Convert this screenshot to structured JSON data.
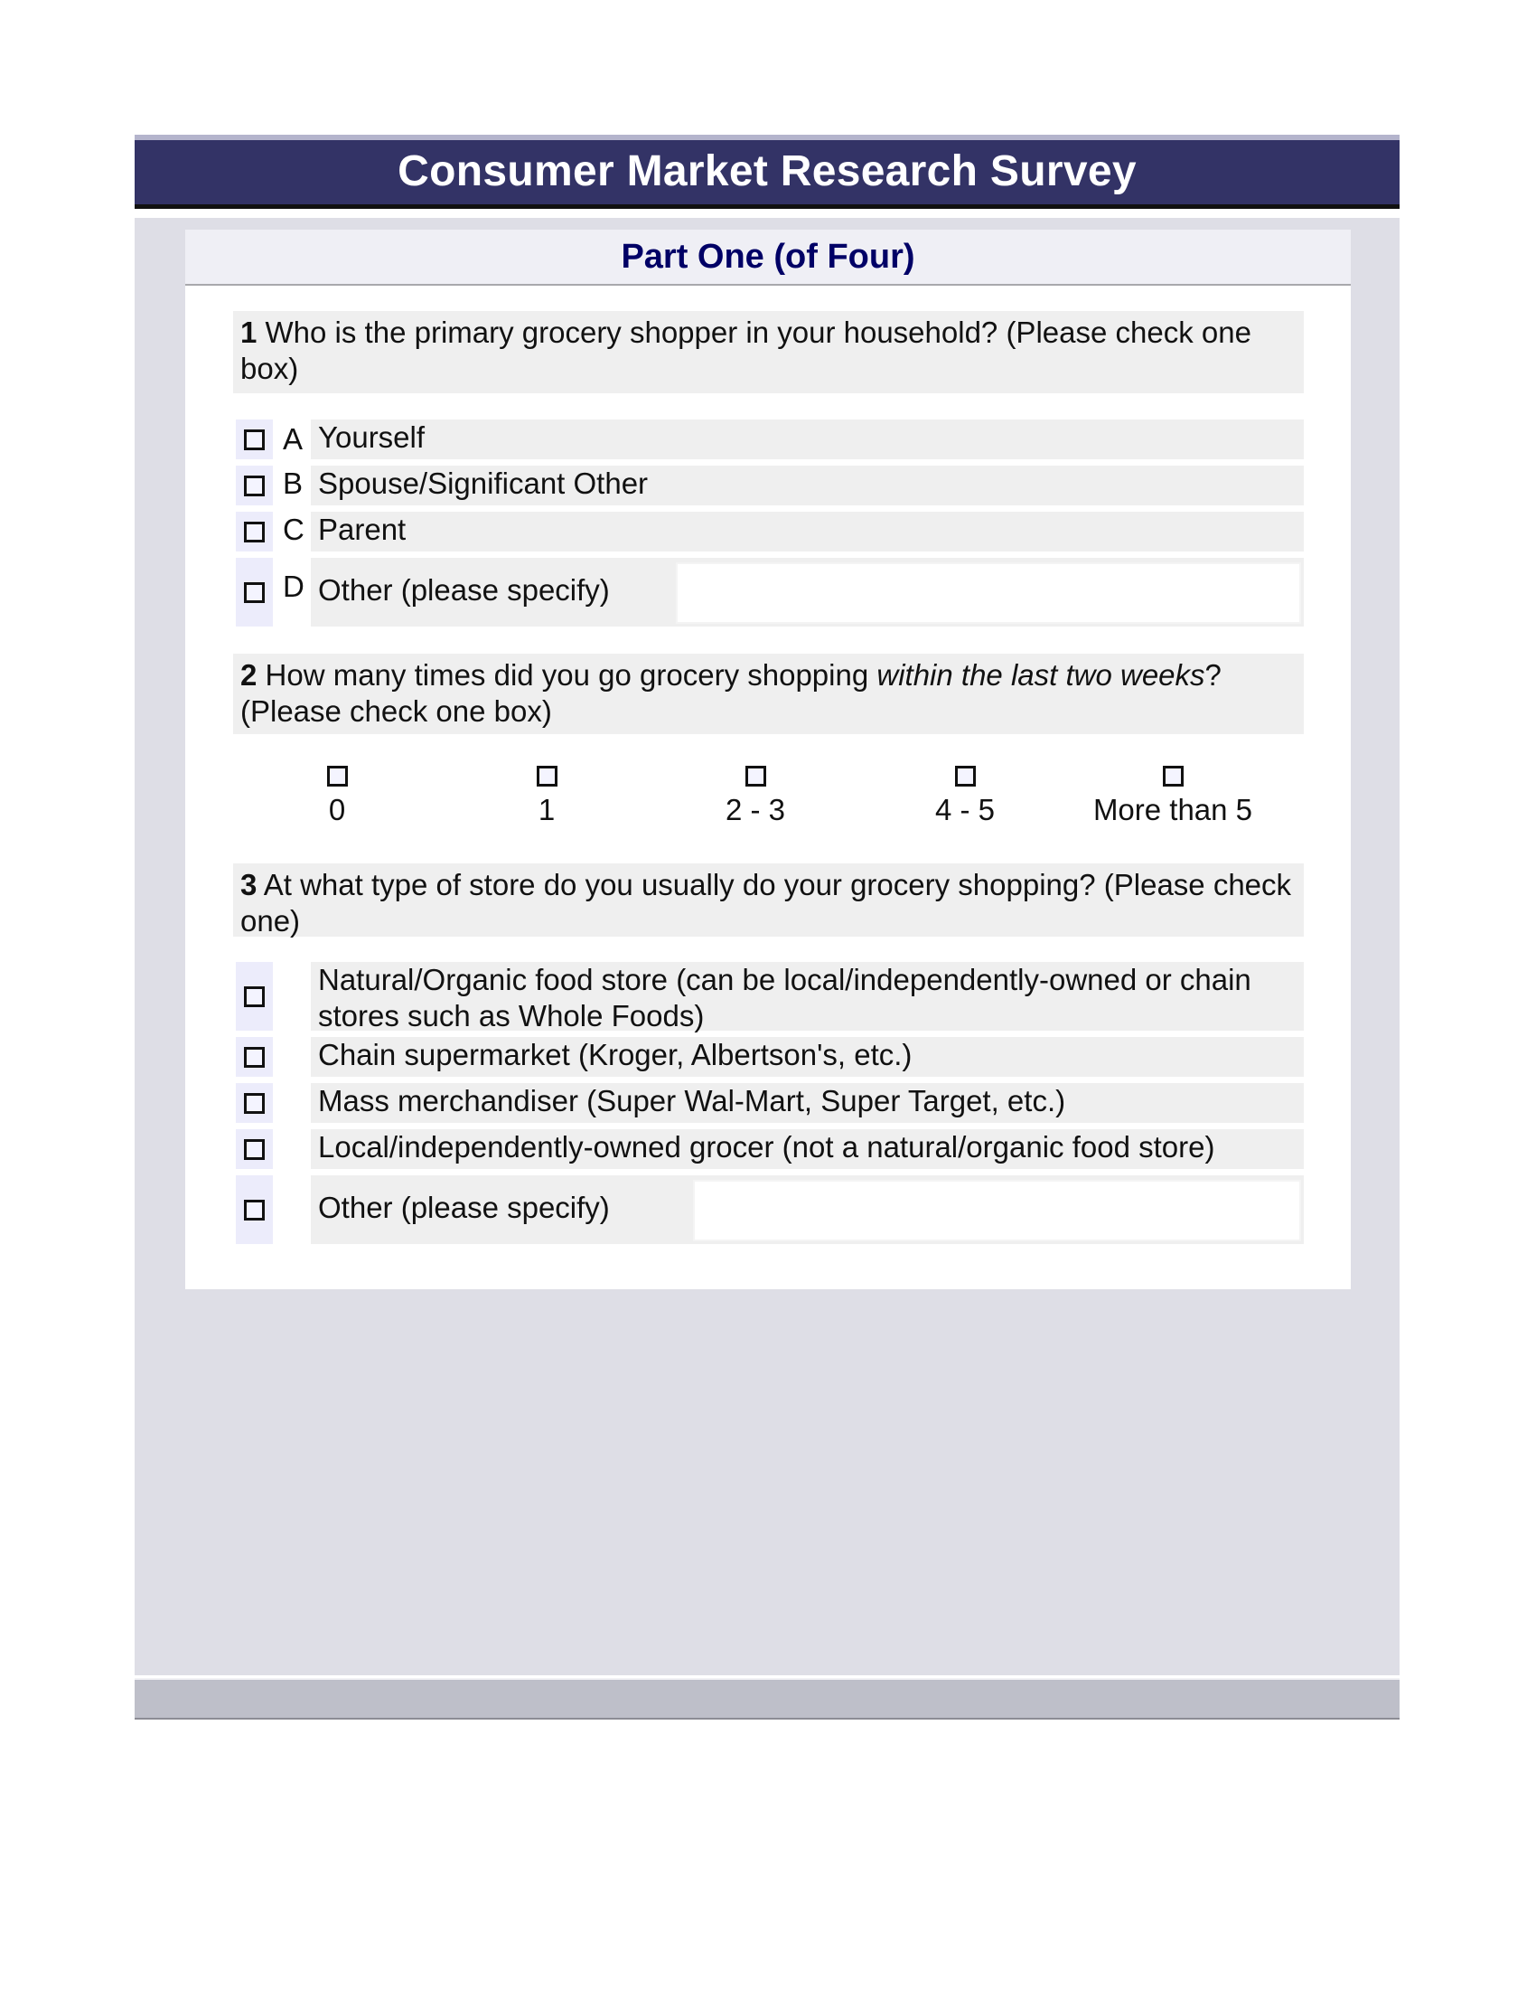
{
  "header": {
    "title": "Consumer Market Research Survey"
  },
  "section": {
    "title": "Part One (of Four)"
  },
  "questions": [
    {
      "number": "1",
      "text": "Who is the primary grocery shopper in your household? (Please check one box)",
      "options": [
        {
          "letter": "A",
          "label": "Yourself",
          "checked": false
        },
        {
          "letter": "B",
          "label": "Spouse/Significant Other",
          "checked": false
        },
        {
          "letter": "C",
          "label": "Parent",
          "checked": false
        },
        {
          "letter": "D",
          "label": "Other (please specify)",
          "checked": false,
          "specify_value": ""
        }
      ]
    },
    {
      "number": "2",
      "text_before": "How many times did you go grocery shopping ",
      "text_italic": "within the last two weeks",
      "text_after": "? (Please check one box)",
      "options": [
        {
          "label": "0",
          "checked": false
        },
        {
          "label": "1",
          "checked": false
        },
        {
          "label": "2 - 3",
          "checked": false
        },
        {
          "label": "4 - 5",
          "checked": false
        },
        {
          "label": "More than 5",
          "checked": false
        }
      ]
    },
    {
      "number": "3",
      "text": "At what type of store do you usually do your grocery shopping? (Please check one)",
      "options": [
        {
          "label": "Natural/Organic food store (can be local/independently-owned or chain stores such as Whole Foods)",
          "checked": false
        },
        {
          "label": "Chain supermarket (Kroger, Albertson's, etc.)",
          "checked": false
        },
        {
          "label": "Mass merchandiser (Super Wal-Mart, Super Target, etc.)",
          "checked": false
        },
        {
          "label": "Local/independently-owned grocer (not a natural/organic food store)",
          "checked": false
        },
        {
          "label": "Other (please specify)",
          "checked": false,
          "specify_value": ""
        }
      ]
    }
  ],
  "colors": {
    "title_bar": "#333366",
    "section_title": "#000066",
    "panel": "#dedee6",
    "footer": "#bebfc9",
    "question_bg": "#efefef",
    "checkbox_column": "#ececfb"
  }
}
